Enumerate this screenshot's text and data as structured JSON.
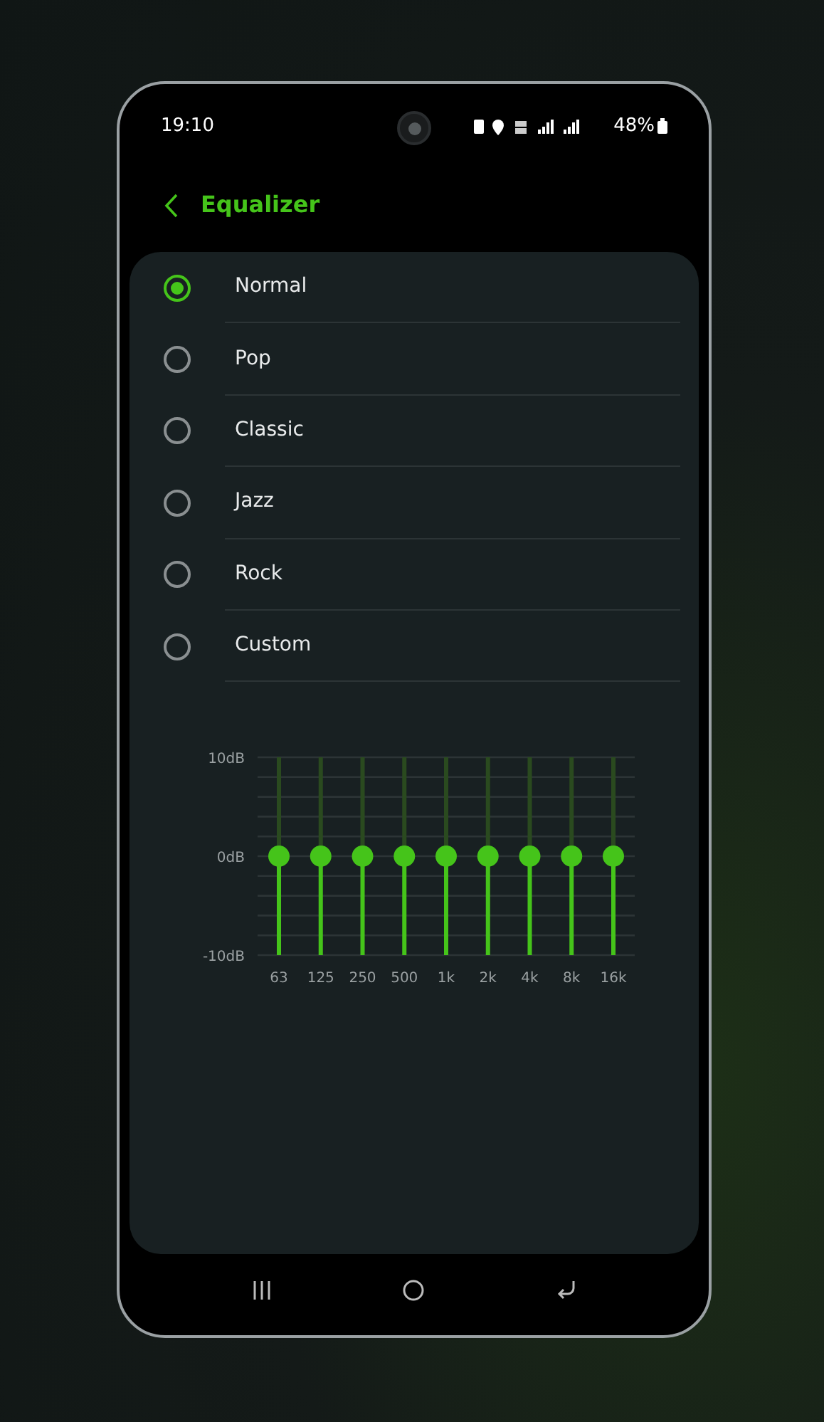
{
  "status_bar": {
    "time": "19:10",
    "battery": "48%"
  },
  "header": {
    "title": "Equalizer"
  },
  "presets": [
    {
      "label": "Normal",
      "selected": true
    },
    {
      "label": "Pop",
      "selected": false
    },
    {
      "label": "Classic",
      "selected": false
    },
    {
      "label": "Jazz",
      "selected": false
    },
    {
      "label": "Rock",
      "selected": false
    },
    {
      "label": "Custom",
      "selected": false
    }
  ],
  "equalizer": {
    "chart_data": {
      "type": "bar",
      "categories": [
        "63",
        "125",
        "250",
        "500",
        "1k",
        "2k",
        "4k",
        "8k",
        "16k"
      ],
      "values": [
        0,
        0,
        0,
        0,
        0,
        0,
        0,
        0,
        0
      ],
      "ylim": [
        -10,
        10
      ],
      "yticks": [
        {
          "value": 10,
          "label": "10dB"
        },
        {
          "value": 0,
          "label": "0dB"
        },
        {
          "value": -10,
          "label": "-10dB"
        }
      ]
    }
  }
}
